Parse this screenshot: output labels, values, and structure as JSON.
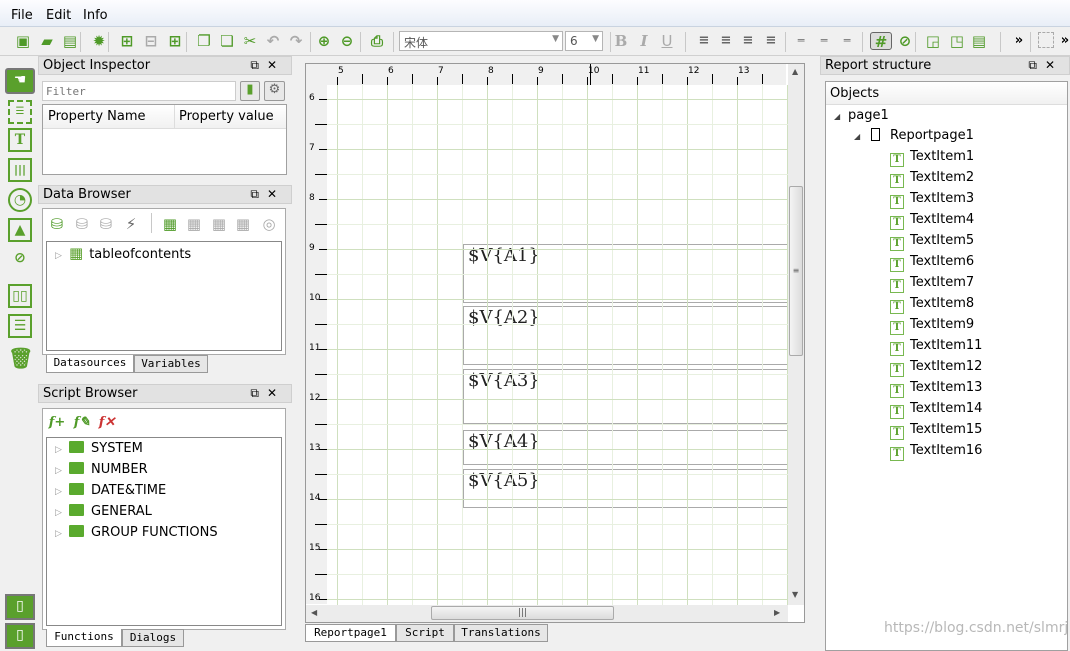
{
  "menu": [
    "File",
    "Edit",
    "Info"
  ],
  "toolbar": {
    "icons": [
      "new-report-icon",
      "open-icon",
      "save-icon",
      "settings-icon",
      "add-page-icon",
      "remove-page-icon",
      "add-dialog-icon",
      "copy-icon",
      "paste-icon",
      "cut-icon",
      "undo-icon",
      "redo-icon",
      "zoom-in-icon",
      "zoom-out-icon",
      "print-preview-icon"
    ],
    "font_family": "宋体",
    "font_size": "6",
    "format": [
      "B",
      "I",
      "U"
    ],
    "overflow": "»"
  },
  "object_inspector": {
    "title": "Object Inspector",
    "filter_placeholder": "Filter",
    "col_name": "Property Name",
    "col_value": "Property value"
  },
  "data_browser": {
    "title": "Data Browser",
    "items": [
      "tableofcontents"
    ],
    "tabs": [
      "Datasources",
      "Variables"
    ]
  },
  "script_browser": {
    "title": "Script Browser",
    "items": [
      "SYSTEM",
      "NUMBER",
      "DATE&TIME",
      "GENERAL",
      "GROUP FUNCTIONS"
    ],
    "tabs": [
      "Functions",
      "Dialogs"
    ]
  },
  "designer": {
    "h_ruler": [
      "5",
      "6",
      "7",
      "8",
      "9",
      "10",
      "11",
      "12",
      "13"
    ],
    "v_ruler": [
      "6",
      "7",
      "8",
      "9",
      "10",
      "11",
      "12",
      "13",
      "14",
      "15",
      "16"
    ],
    "fields": [
      "$V{A1}",
      "$V{A2}",
      "$V{A3}",
      "$V{A4}",
      "$V{A5}"
    ],
    "tabs": [
      "Reportpage1",
      "Script",
      "Translations"
    ]
  },
  "report_structure": {
    "title": "Report structure",
    "header": "Objects",
    "page": "page1",
    "reportpage": "Reportpage1",
    "items": [
      "TextItem1",
      "TextItem2",
      "TextItem3",
      "TextItem4",
      "TextItem5",
      "TextItem6",
      "TextItem7",
      "TextItem8",
      "TextItem9",
      "TextItem11",
      "TextItem12",
      "TextItem13",
      "TextItem14",
      "TextItem15",
      "TextItem16"
    ]
  },
  "watermark": "https://blog.csdn.net/slmrj",
  "colors": {
    "accent": "#5aa02c",
    "grid_major": "#cfe0bf",
    "grid_minor": "#e8f0e0"
  }
}
